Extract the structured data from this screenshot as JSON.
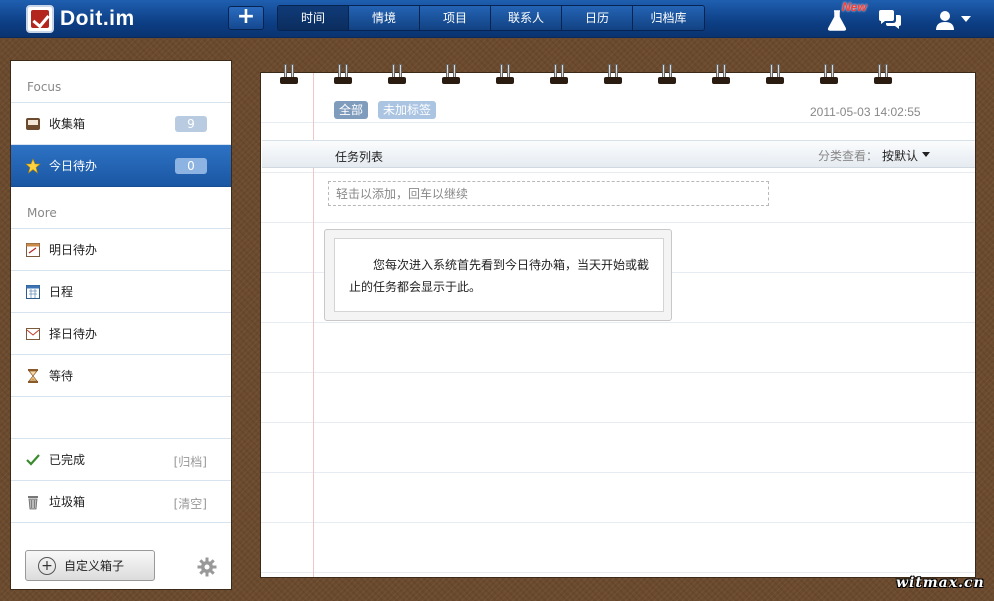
{
  "app": {
    "name": "Doit.im",
    "add_label": "+",
    "new_badge": "New"
  },
  "nav": {
    "items": [
      {
        "label": "时间",
        "active": true
      },
      {
        "label": "情境",
        "active": false
      },
      {
        "label": "项目",
        "active": false
      },
      {
        "label": "联系人",
        "active": false
      },
      {
        "label": "日历",
        "active": false
      },
      {
        "label": "归档库",
        "active": false
      }
    ]
  },
  "sidebar": {
    "section_focus": "Focus",
    "inbox": {
      "label": "收集箱",
      "count": "9",
      "icon": "inbox-icon"
    },
    "today": {
      "label": "今日待办",
      "count": "0",
      "icon": "star-icon"
    },
    "section_more": "More",
    "tomorrow": {
      "label": "明日待办",
      "icon": "calendar-page-icon"
    },
    "schedule": {
      "label": "日程",
      "icon": "calendar-grid-icon"
    },
    "someday": {
      "label": "择日待办",
      "icon": "envelope-calendar-icon"
    },
    "waiting": {
      "label": "等待",
      "icon": "hourglass-icon"
    },
    "completed": {
      "label": "已完成",
      "extra": "[归档]",
      "icon": "checkmark-icon"
    },
    "trash": {
      "label": "垃圾箱",
      "extra": "[清空]",
      "icon": "trash-icon"
    },
    "custom_box_label": "自定义箱子"
  },
  "main": {
    "tags": [
      "全部",
      "未加标签"
    ],
    "datetime": "2011-05-03 14:02:55",
    "list_title": "任务列表",
    "sort_label": "分类查看：",
    "sort_value": "按默认",
    "quick_add_placeholder": "轻击以添加，回车以继续",
    "hint": "您每次进入系统首先看到今日待办箱，当天开始或截止的任务都会显示于此。"
  },
  "watermark": "witmax.cn",
  "colors": {
    "topbar": "#0d3f85",
    "active_item": "#1f62b5",
    "wood": "#6b4a2d",
    "badge": "#b9cbe0",
    "new_badge": "#ff3b2f"
  }
}
